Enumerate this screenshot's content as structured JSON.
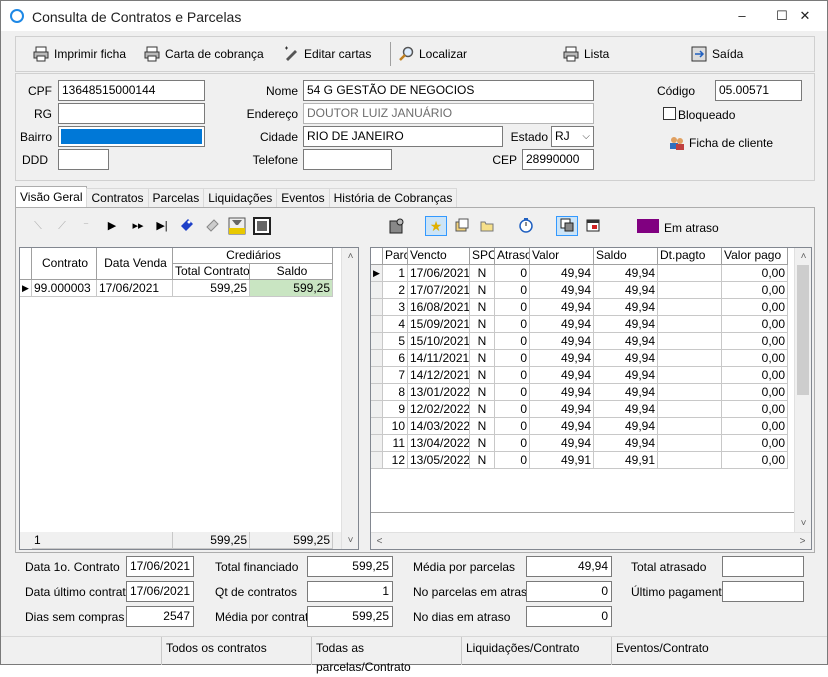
{
  "window": {
    "title": "Consulta de Contratos e Parcelas",
    "min": "–",
    "max": "☐",
    "close": "✕"
  },
  "toolbar": {
    "print": "Imprimir ficha",
    "letter": "Carta de cobrança",
    "edit": "Editar cartas",
    "find": "Localizar",
    "list": "Lista",
    "exit": "Saída"
  },
  "form": {
    "cpf_label": "CPF",
    "cpf": "13648515000144",
    "rg_label": "RG",
    "rg": "",
    "bairro_label": "Bairro",
    "bairro": "",
    "ddd_label": "DDD",
    "ddd": "",
    "nome_label": "Nome",
    "nome": "54 G GESTÃO DE NEGOCIOS",
    "endereco_label": "Endereço",
    "endereco": "DOUTOR LUIZ JANUÁRIO",
    "cidade_label": "Cidade",
    "cidade": "RIO DE JANEIRO",
    "estado_label": "Estado",
    "estado": "RJ",
    "telefone_label": "Telefone",
    "telefone": "",
    "cep_label": "CEP",
    "cep": "28990000",
    "codigo_label": "Código",
    "codigo": "05.00571",
    "bloqueado": "Bloqueado",
    "ficha": "Ficha de cliente"
  },
  "tabs": [
    "Visão Geral",
    "Contratos",
    "Parcelas",
    "Liquidações",
    "Eventos",
    "História de Cobranças"
  ],
  "legend": {
    "color": "#800080",
    "label": "Em atraso"
  },
  "contracts": {
    "headers": {
      "contrato": "Contrato",
      "data_venda": "Data Venda",
      "crediarios": "Crediários",
      "total": "Total Contrato",
      "saldo": "Saldo"
    },
    "rows": [
      {
        "contrato": "99.000003",
        "data": "17/06/2021",
        "total": "599,25",
        "saldo": "599,25"
      }
    ],
    "footer": {
      "count": "1",
      "total": "599,25",
      "saldo": "599,25"
    },
    "saldo_color": "#c9e5c2"
  },
  "parcelas": {
    "headers": [
      "Parc",
      "Vencto",
      "SPC",
      "Atraso",
      "Valor",
      "Saldo",
      "Dt.pagto",
      "Valor pago"
    ],
    "rows": [
      [
        "1",
        "17/06/2021",
        "N",
        "0",
        "49,94",
        "49,94",
        "",
        "0,00"
      ],
      [
        "2",
        "17/07/2021",
        "N",
        "0",
        "49,94",
        "49,94",
        "",
        "0,00"
      ],
      [
        "3",
        "16/08/2021",
        "N",
        "0",
        "49,94",
        "49,94",
        "",
        "0,00"
      ],
      [
        "4",
        "15/09/2021",
        "N",
        "0",
        "49,94",
        "49,94",
        "",
        "0,00"
      ],
      [
        "5",
        "15/10/2021",
        "N",
        "0",
        "49,94",
        "49,94",
        "",
        "0,00"
      ],
      [
        "6",
        "14/11/2021",
        "N",
        "0",
        "49,94",
        "49,94",
        "",
        "0,00"
      ],
      [
        "7",
        "14/12/2021",
        "N",
        "0",
        "49,94",
        "49,94",
        "",
        "0,00"
      ],
      [
        "8",
        "13/01/2022",
        "N",
        "0",
        "49,94",
        "49,94",
        "",
        "0,00"
      ],
      [
        "9",
        "12/02/2022",
        "N",
        "0",
        "49,94",
        "49,94",
        "",
        "0,00"
      ],
      [
        "10",
        "14/03/2022",
        "N",
        "0",
        "49,94",
        "49,94",
        "",
        "0,00"
      ],
      [
        "11",
        "13/04/2022",
        "N",
        "0",
        "49,94",
        "49,94",
        "",
        "0,00"
      ],
      [
        "12",
        "13/05/2022",
        "N",
        "0",
        "49,91",
        "49,91",
        "",
        "0,00"
      ]
    ]
  },
  "summary": {
    "data1_label": "Data 1o. Contrato",
    "data1": "17/06/2021",
    "dataU_label": "Data último contrato",
    "dataU": "17/06/2021",
    "dias_label": "Dias sem compras",
    "dias": "2547",
    "totfin_label": "Total financiado",
    "totfin": "599,25",
    "qt_label": "Qt de contratos",
    "qt": "1",
    "media_contr_label": "Média por contrato",
    "media_contr": "599,25",
    "media_parc_label": "Média por parcelas",
    "media_parc": "49,94",
    "noparc_label": "No parcelas em atraso",
    "noparc": "0",
    "nodias_label": "No dias em atraso",
    "nodias": "0",
    "totatr_label": "Total atrasado",
    "totatr": "",
    "ultpag_label": "Último pagamento",
    "ultpag": ""
  },
  "status": [
    "",
    "Todos os contratos",
    "Todas as parcelas/Contrato",
    "Liquidações/Contrato",
    "Eventos/Contrato"
  ]
}
